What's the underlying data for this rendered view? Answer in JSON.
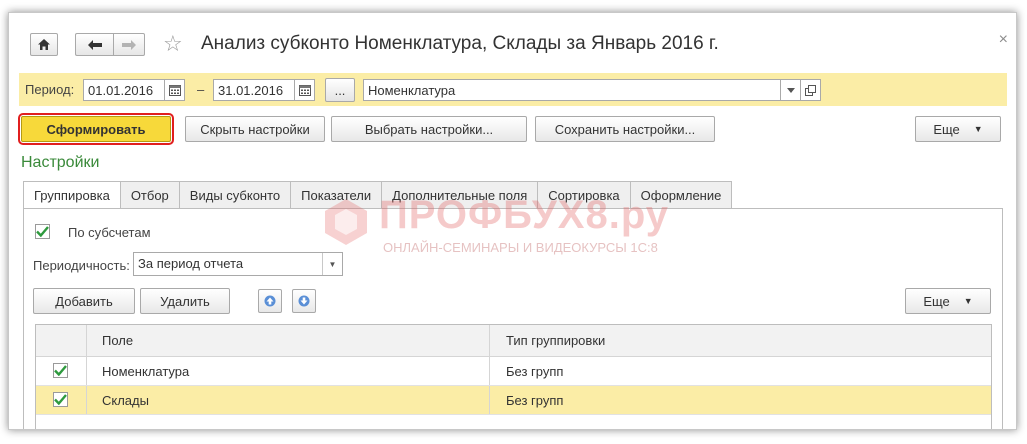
{
  "window": {
    "title": "Анализ субконто Номенклатура, Склады за Январь 2016 г.",
    "close_symbol": "×"
  },
  "period": {
    "label": "Период:",
    "from": "01.01.2016",
    "dash": "–",
    "to": "31.01.2016",
    "dots": "...",
    "subconto": "Номенклатура"
  },
  "toolbar": {
    "generate_label": "Сформировать",
    "hide_settings_label": "Скрыть настройки",
    "choose_settings_label": "Выбрать настройки...",
    "save_settings_label": "Сохранить настройки...",
    "more_label": "Еще"
  },
  "settings": {
    "title": "Настройки",
    "tabs": [
      {
        "label": "Группировка",
        "active": true
      },
      {
        "label": "Отбор",
        "active": false
      },
      {
        "label": "Виды субконто",
        "active": false
      },
      {
        "label": "Показатели",
        "active": false
      },
      {
        "label": "Дополнительные поля",
        "active": false
      },
      {
        "label": "Сортировка",
        "active": false
      },
      {
        "label": "Оформление",
        "active": false
      }
    ],
    "by_subaccounts_label": "По субсчетам",
    "by_subaccounts_checked": true,
    "periodicity_label": "Периодичность:",
    "periodicity_value": "За период отчета",
    "add_label": "Добавить",
    "delete_label": "Удалить",
    "more_label": "Еще"
  },
  "watermark": {
    "title": "ПРОФБУХ8.ру",
    "subtitle": "ОНЛАЙН-СЕМИНАРЫ И ВИДЕОКУРСЫ 1С:8"
  },
  "grouping_table": {
    "columns": [
      "Поле",
      "Тип группировки"
    ],
    "rows": [
      {
        "field": "Номенклатура",
        "type": "Без групп",
        "checked": true,
        "selected": false
      },
      {
        "field": "Склады",
        "type": "Без групп",
        "checked": true,
        "selected": true
      }
    ]
  },
  "colors": {
    "accent_yellow": "#f7d93a",
    "highlight_row": "#fbeda6",
    "section_green": "#3a8a3a",
    "check_green": "#2e9a3e",
    "focus_red": "#e11f1f"
  }
}
